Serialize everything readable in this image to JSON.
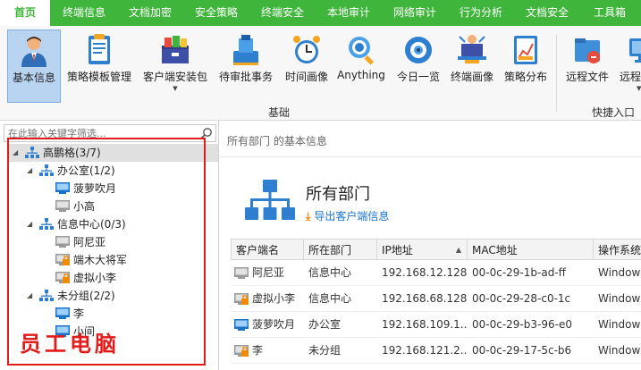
{
  "menu": {
    "tabs": [
      {
        "label": "首页",
        "active": true
      },
      {
        "label": "终端信息",
        "active": false
      },
      {
        "label": "文档加密",
        "active": false
      },
      {
        "label": "安全策略",
        "active": false
      },
      {
        "label": "终端安全",
        "active": false
      },
      {
        "label": "本地审计",
        "active": false
      },
      {
        "label": "网络审计",
        "active": false
      },
      {
        "label": "行为分析",
        "active": false
      },
      {
        "label": "文档安全",
        "active": false
      },
      {
        "label": "工具箱",
        "active": false
      }
    ]
  },
  "ribbon": {
    "tools": [
      {
        "label": "基本信息",
        "icon": "user-icon",
        "selected": true
      },
      {
        "label": "策略模板管理",
        "icon": "policy-template-icon"
      },
      {
        "label": "客户端安装包",
        "icon": "install-package-icon",
        "dropdown": true
      },
      {
        "label": "待审批事务",
        "icon": "approval-icon"
      },
      {
        "label": "时间画像",
        "icon": "alarm-clock-icon"
      },
      {
        "label": "Anything",
        "icon": "search-globe-icon"
      },
      {
        "label": "今日一览",
        "icon": "eye-icon"
      },
      {
        "label": "终端画像",
        "icon": "terminal-profile-icon"
      },
      {
        "label": "策略分布",
        "icon": "chart-icon"
      },
      {
        "label": "远程文件",
        "icon": "remote-file-icon"
      },
      {
        "label": "远程",
        "icon": "remote-desktop-icon",
        "dropdown": true
      }
    ],
    "groups": [
      "基础",
      "快捷入口"
    ]
  },
  "left": {
    "search_placeholder": "在此输入关键字筛选...",
    "tree": {
      "root": "高鹏格(3/7)",
      "groups": [
        {
          "label": "办公室(1/2)",
          "items": [
            {
              "label": "菠萝吹月",
              "status": "online",
              "locked": false
            },
            {
              "label": "小高",
              "status": "offline",
              "locked": false
            }
          ]
        },
        {
          "label": "信息中心(0/3)",
          "items": [
            {
              "label": "阿尼亚",
              "status": "offline",
              "locked": false
            },
            {
              "label": "端木大将军",
              "status": "offline",
              "locked": true
            },
            {
              "label": "虚拟小李",
              "status": "offline",
              "locked": true
            }
          ]
        },
        {
          "label": "未分组(2/2)",
          "items": [
            {
              "label": "李",
              "status": "online",
              "locked": false
            },
            {
              "label": "小间",
              "status": "online",
              "locked": false
            }
          ]
        }
      ]
    },
    "caption": "员工电脑"
  },
  "right": {
    "breadcrumb": "所有部门 的基本信息",
    "title": "所有部门",
    "export_label": "导出客户端信息",
    "columns": [
      "客户端名",
      "所在部门",
      "IP地址",
      "MAC地址",
      "操作系统"
    ],
    "rows": [
      {
        "name": "阿尼亚",
        "dept": "信息中心",
        "ip": "192.168.12.128",
        "mac": "00-0c-29-1b-ad-ff",
        "os": "Windows",
        "status": "offline",
        "locked": false
      },
      {
        "name": "虚拟小李",
        "dept": "信息中心",
        "ip": "192.168.68.128",
        "mac": "00-0c-29-28-c0-1c",
        "os": "Windows",
        "status": "offline",
        "locked": true
      },
      {
        "name": "菠萝吹月",
        "dept": "办公室",
        "ip": "192.168.109.1...",
        "mac": "00-0c-29-b3-96-e0",
        "os": "Windows",
        "status": "online",
        "locked": false
      },
      {
        "name": "李",
        "dept": "未分组",
        "ip": "192.168.121.2...",
        "mac": "00-0c-29-17-5c-b6",
        "os": "Windows",
        "status": "offline",
        "locked": true
      }
    ]
  },
  "colors": {
    "brand": "#3fb53c",
    "highlight": "#e21b1b",
    "link": "#1a73c8",
    "online": "#1e73c8",
    "offline": "#9a9a9a"
  }
}
